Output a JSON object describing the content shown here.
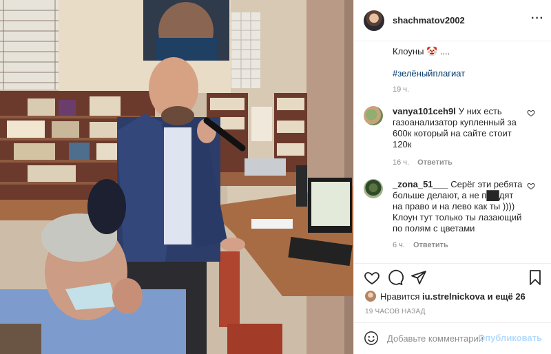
{
  "post": {
    "username": "shachmatov2002",
    "caption": "Клоуны 🤡 ....",
    "hashtag": "#зелёныйплагиат",
    "caption_time": "19 ч."
  },
  "comments": [
    {
      "username": "vanya101ceh9l",
      "text": "У них есть газоанализатор купленный за 600к который на сайте стоит 120к",
      "time": "16 ч.",
      "reply_label": "Ответить"
    },
    {
      "username": "_zona_51___",
      "text": "Серёг эти ребята больше делают, а не п██дят на право и на лево как ты )))) Клоун тут только ты лазающий по полям с цветами",
      "time": "6 ч.",
      "reply_label": "Ответить"
    }
  ],
  "likes": {
    "prefix": "Нравится",
    "user": "iu.strelnickova",
    "suffix": "и ещё 26"
  },
  "post_time": "19 ЧАСОВ НАЗАД",
  "add_comment": {
    "placeholder": "Добавьте комментарий...",
    "post_label": "Опубликовать"
  },
  "icons": {
    "more": "more-options-icon",
    "like": "heart-icon",
    "comment": "comment-icon",
    "share": "paper-plane-icon",
    "save": "bookmark-icon",
    "emoji": "emoji-icon"
  },
  "colors": {
    "hashtag": "#00376b",
    "secondary_text": "#8e8e8e",
    "post_button_disabled": "#b3dbff"
  }
}
